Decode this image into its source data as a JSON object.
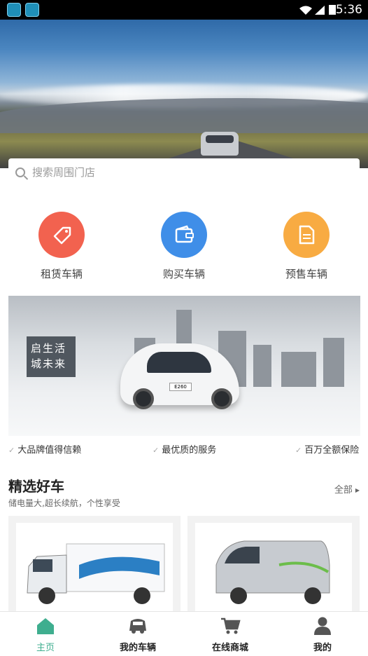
{
  "status_bar": {
    "time": "5:36"
  },
  "search": {
    "placeholder": "搜索周围门店"
  },
  "categories": [
    {
      "label": "租赁车辆",
      "color": "#f2624f",
      "icon": "tag-icon"
    },
    {
      "label": "购买车辆",
      "color": "#3f8ee8",
      "icon": "wallet-icon"
    },
    {
      "label": "预售车辆",
      "color": "#f8ab42",
      "icon": "document-icon"
    }
  ],
  "banner": {
    "sign_text": "启生活城未来",
    "plate": "E260",
    "carousel_total": 2,
    "carousel_active": 2
  },
  "features": [
    "大品牌值得信赖",
    "最优质的服务",
    "百万全额保险"
  ],
  "featured": {
    "title": "精选好车",
    "subtitle": "储电量大,超长续航，个性享受",
    "see_all": "全部"
  },
  "tabs": [
    {
      "label": "主页",
      "icon": "home-icon",
      "active": true
    },
    {
      "label": "我的车辆",
      "icon": "car-icon",
      "active": false
    },
    {
      "label": "在线商城",
      "icon": "cart-icon",
      "active": false
    },
    {
      "label": "我的",
      "icon": "user-icon",
      "active": false
    }
  ],
  "colors": {
    "accent": "#3fae8f",
    "status_bar": "#000000"
  }
}
